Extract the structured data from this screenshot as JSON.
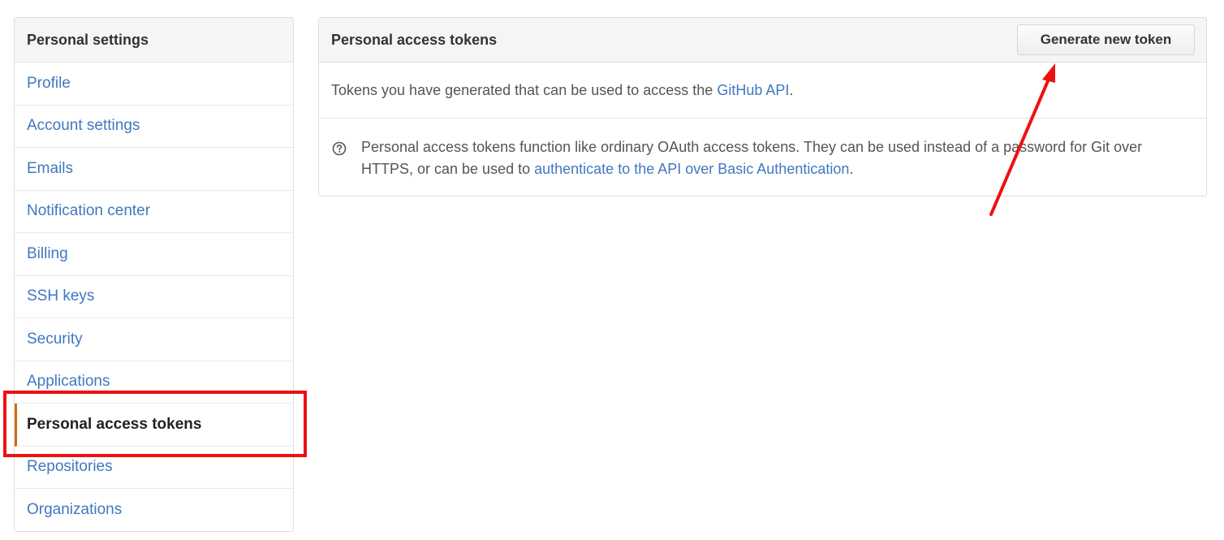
{
  "sidebar": {
    "title": "Personal settings",
    "items": [
      {
        "label": "Profile"
      },
      {
        "label": "Account settings"
      },
      {
        "label": "Emails"
      },
      {
        "label": "Notification center"
      },
      {
        "label": "Billing"
      },
      {
        "label": "SSH keys"
      },
      {
        "label": "Security"
      },
      {
        "label": "Applications"
      },
      {
        "label": "Personal access tokens",
        "selected": true
      },
      {
        "label": "Repositories"
      },
      {
        "label": "Organizations"
      }
    ]
  },
  "main": {
    "title": "Personal access tokens",
    "generate_button": "Generate new token",
    "intro_text": "Tokens you have generated that can be used to access the ",
    "intro_link": "GitHub API",
    "intro_end": ".",
    "help_text": "Personal access tokens function like ordinary OAuth access tokens. They can be used instead of a password for Git over HTTPS, or can be used to ",
    "help_link": "authenticate to the API over Basic Authentication",
    "help_end": ".",
    "help_icon": "question-circle-icon"
  },
  "annotation": {
    "color": "#ee1111"
  },
  "colors": {
    "link": "#4078c0",
    "selected_accent": "#d26911",
    "header_bg": "#f5f5f5"
  }
}
